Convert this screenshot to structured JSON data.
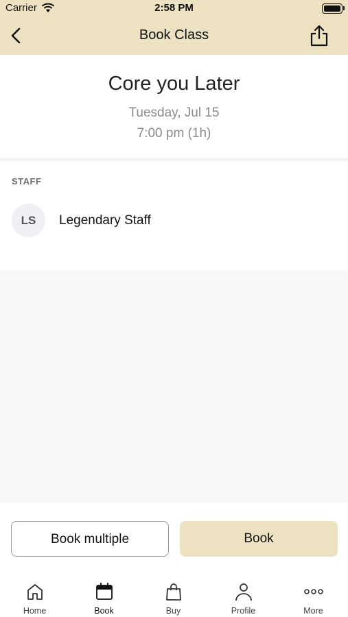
{
  "status_bar": {
    "carrier": "Carrier",
    "time": "2:58 PM"
  },
  "navbar": {
    "title": "Book Class",
    "back_icon": "chevron-left-icon",
    "share_icon": "share-icon"
  },
  "class_info": {
    "title": "Core you Later",
    "date": "Tuesday, Jul 15",
    "time": "7:00 pm (1h)"
  },
  "staff": {
    "heading": "STAFF",
    "members": [
      {
        "initials": "LS",
        "name": "Legendary Staff"
      }
    ]
  },
  "actions": {
    "book_multiple_label": "Book multiple",
    "book_label": "Book"
  },
  "tabbar": {
    "items": [
      {
        "label": "Home",
        "icon": "home-icon"
      },
      {
        "label": "Book",
        "icon": "calendar-icon",
        "active": true
      },
      {
        "label": "Buy",
        "icon": "shopping-bag-icon"
      },
      {
        "label": "Profile",
        "icon": "person-icon"
      },
      {
        "label": "More",
        "icon": "more-dots-icon"
      }
    ]
  },
  "colors": {
    "accent": "#ece2c2",
    "muted_text": "#8a8a8a",
    "background_grey": "#f7f8fa"
  }
}
